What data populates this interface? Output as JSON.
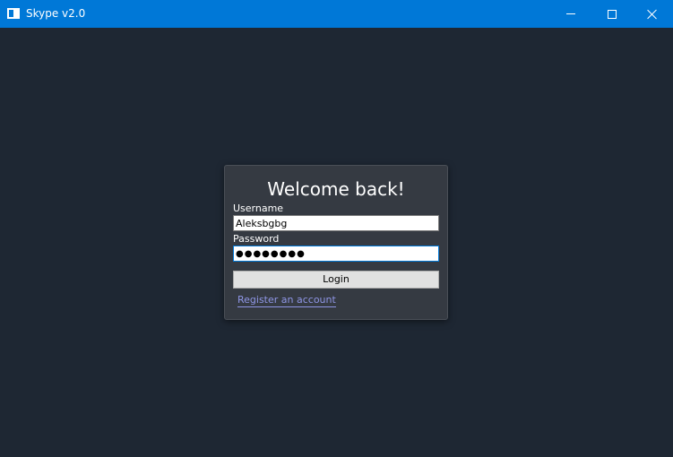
{
  "window": {
    "title": "Skype v2.0",
    "accent_color": "#0078d7",
    "background_color": "#1e2733",
    "icons": {
      "app": "app-icon",
      "minimize": "minimize-icon",
      "maximize": "maximize-icon",
      "close": "close-icon"
    }
  },
  "login": {
    "heading": "Welcome back!",
    "username_label": "Username",
    "username_value": "Aleksbgbg",
    "password_label": "Password",
    "password_value": "●●●●●●●●",
    "login_button": "Login",
    "register_link": "Register an account",
    "link_color": "#8f96e6"
  }
}
